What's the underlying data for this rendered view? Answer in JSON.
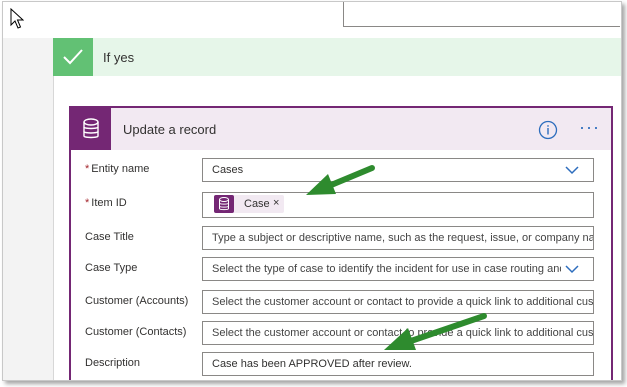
{
  "branch": {
    "label": "If yes"
  },
  "action": {
    "title": "Update a record",
    "info_icon": "info-icon",
    "more_icon": "more-options-icon",
    "more_glyph": "···"
  },
  "fields": {
    "entity_name": {
      "label": "Entity name",
      "required": "*",
      "value": "Cases"
    },
    "item_id": {
      "label": "Item ID",
      "required": "*",
      "token_label": "Case",
      "token_remove": "×"
    },
    "case_title": {
      "label": "Case Title",
      "placeholder": "Type a subject or descriptive name, such as the request, issue, or company name"
    },
    "case_type": {
      "label": "Case Type",
      "placeholder": "Select the type of case to identify the incident for use in case routing and analysis"
    },
    "customer_accounts": {
      "label": "Customer (Accounts)",
      "placeholder": "Select the customer account or contact to provide a quick link to additional customer details"
    },
    "customer_contacts": {
      "label": "Customer (Contacts)",
      "placeholder": "Select the customer account or contact to provide a quick link to additional customer details"
    },
    "description": {
      "label": "Description",
      "value": "Case has been APPROVED after review."
    }
  },
  "colors": {
    "purple": "#742774",
    "green_check": "#62c174",
    "green_header": "#e6f6e9",
    "arrow_green": "#2e8b2e",
    "link_blue": "#2d6dbd"
  }
}
